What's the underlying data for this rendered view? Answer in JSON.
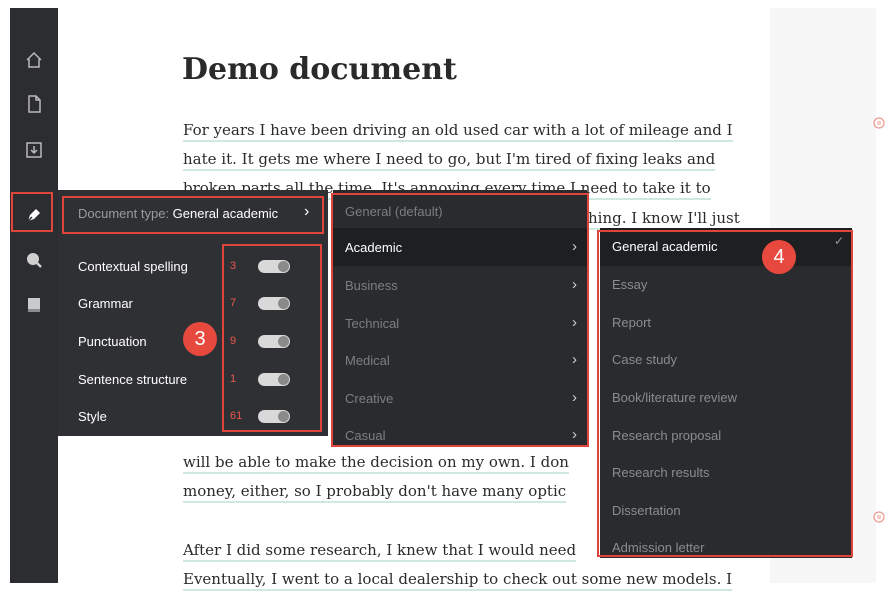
{
  "sidebar": {
    "icons": [
      "home-icon",
      "new-document-icon",
      "download-icon",
      "pen-icon",
      "search-icon",
      "book-icon"
    ]
  },
  "document": {
    "title": "Demo document",
    "lines": [
      "For years I have been driving an old used car with a lot of mileage and I",
      "hate it. It gets me where I need to go, but I'm tired of fixing leaks and",
      "broken parts all the time. It's annoying every time I need to take it to",
      "hing. I know I'll just",
      "will be able to make the decision on my own. I don",
      "money, either, so I probably don't have many optic",
      "After I did some research, I knew that I would need",
      "Eventually, I went to a local dealership to check out some new models. I"
    ]
  },
  "goals_panel": {
    "document_type_prefix": "Document type:",
    "document_type_value": "General academic",
    "chevron": "›",
    "rows": [
      {
        "label": "Contextual spelling",
        "count": "3"
      },
      {
        "label": "Grammar",
        "count": "7"
      },
      {
        "label": "Punctuation",
        "count": "9"
      },
      {
        "label": "Sentence structure",
        "count": "1"
      },
      {
        "label": "Style",
        "count": "61"
      }
    ]
  },
  "category_menu": {
    "default_item": "General (default)",
    "items": [
      {
        "label": "Academic",
        "chevron": "›"
      },
      {
        "label": "Business",
        "chevron": "›"
      },
      {
        "label": "Technical",
        "chevron": "›"
      },
      {
        "label": "Medical",
        "chevron": "›"
      },
      {
        "label": "Creative",
        "chevron": "›"
      },
      {
        "label": "Casual",
        "chevron": "›"
      }
    ]
  },
  "subtype_menu": {
    "checkmark": "✓",
    "items": [
      "General academic",
      "Essay",
      "Report",
      "Case study",
      "Book/literature review",
      "Research proposal",
      "Research results",
      "Dissertation",
      "Admission letter"
    ]
  },
  "annotations": {
    "badge_3": "3",
    "badge_4": "4"
  },
  "colors": {
    "sidebar_bg": "#2c2d30",
    "menu_bg": "#2a2b2e",
    "highlight": "#e0453b",
    "count_red": "#e9584e",
    "underline": "#cfe9dd"
  }
}
